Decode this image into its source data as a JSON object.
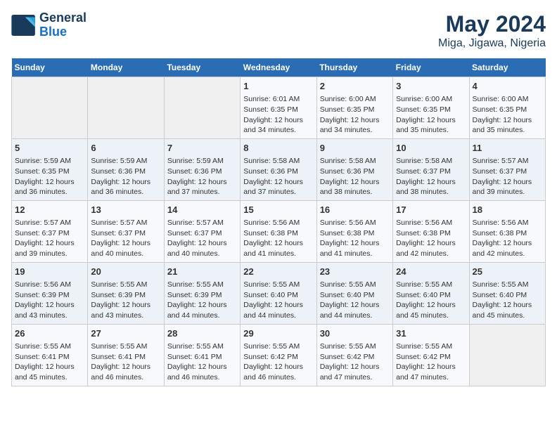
{
  "header": {
    "logo_line1": "General",
    "logo_line2": "Blue",
    "title": "May 2024",
    "subtitle": "Miga, Jigawa, Nigeria"
  },
  "weekdays": [
    "Sunday",
    "Monday",
    "Tuesday",
    "Wednesday",
    "Thursday",
    "Friday",
    "Saturday"
  ],
  "weeks": [
    [
      {
        "num": "",
        "info": ""
      },
      {
        "num": "",
        "info": ""
      },
      {
        "num": "",
        "info": ""
      },
      {
        "num": "1",
        "info": "Sunrise: 6:01 AM\nSunset: 6:35 PM\nDaylight: 12 hours\nand 34 minutes."
      },
      {
        "num": "2",
        "info": "Sunrise: 6:00 AM\nSunset: 6:35 PM\nDaylight: 12 hours\nand 34 minutes."
      },
      {
        "num": "3",
        "info": "Sunrise: 6:00 AM\nSunset: 6:35 PM\nDaylight: 12 hours\nand 35 minutes."
      },
      {
        "num": "4",
        "info": "Sunrise: 6:00 AM\nSunset: 6:35 PM\nDaylight: 12 hours\nand 35 minutes."
      }
    ],
    [
      {
        "num": "5",
        "info": "Sunrise: 5:59 AM\nSunset: 6:35 PM\nDaylight: 12 hours\nand 36 minutes."
      },
      {
        "num": "6",
        "info": "Sunrise: 5:59 AM\nSunset: 6:36 PM\nDaylight: 12 hours\nand 36 minutes."
      },
      {
        "num": "7",
        "info": "Sunrise: 5:59 AM\nSunset: 6:36 PM\nDaylight: 12 hours\nand 37 minutes."
      },
      {
        "num": "8",
        "info": "Sunrise: 5:58 AM\nSunset: 6:36 PM\nDaylight: 12 hours\nand 37 minutes."
      },
      {
        "num": "9",
        "info": "Sunrise: 5:58 AM\nSunset: 6:36 PM\nDaylight: 12 hours\nand 38 minutes."
      },
      {
        "num": "10",
        "info": "Sunrise: 5:58 AM\nSunset: 6:37 PM\nDaylight: 12 hours\nand 38 minutes."
      },
      {
        "num": "11",
        "info": "Sunrise: 5:57 AM\nSunset: 6:37 PM\nDaylight: 12 hours\nand 39 minutes."
      }
    ],
    [
      {
        "num": "12",
        "info": "Sunrise: 5:57 AM\nSunset: 6:37 PM\nDaylight: 12 hours\nand 39 minutes."
      },
      {
        "num": "13",
        "info": "Sunrise: 5:57 AM\nSunset: 6:37 PM\nDaylight: 12 hours\nand 40 minutes."
      },
      {
        "num": "14",
        "info": "Sunrise: 5:57 AM\nSunset: 6:37 PM\nDaylight: 12 hours\nand 40 minutes."
      },
      {
        "num": "15",
        "info": "Sunrise: 5:56 AM\nSunset: 6:38 PM\nDaylight: 12 hours\nand 41 minutes."
      },
      {
        "num": "16",
        "info": "Sunrise: 5:56 AM\nSunset: 6:38 PM\nDaylight: 12 hours\nand 41 minutes."
      },
      {
        "num": "17",
        "info": "Sunrise: 5:56 AM\nSunset: 6:38 PM\nDaylight: 12 hours\nand 42 minutes."
      },
      {
        "num": "18",
        "info": "Sunrise: 5:56 AM\nSunset: 6:38 PM\nDaylight: 12 hours\nand 42 minutes."
      }
    ],
    [
      {
        "num": "19",
        "info": "Sunrise: 5:56 AM\nSunset: 6:39 PM\nDaylight: 12 hours\nand 43 minutes."
      },
      {
        "num": "20",
        "info": "Sunrise: 5:55 AM\nSunset: 6:39 PM\nDaylight: 12 hours\nand 43 minutes."
      },
      {
        "num": "21",
        "info": "Sunrise: 5:55 AM\nSunset: 6:39 PM\nDaylight: 12 hours\nand 44 minutes."
      },
      {
        "num": "22",
        "info": "Sunrise: 5:55 AM\nSunset: 6:40 PM\nDaylight: 12 hours\nand 44 minutes."
      },
      {
        "num": "23",
        "info": "Sunrise: 5:55 AM\nSunset: 6:40 PM\nDaylight: 12 hours\nand 44 minutes."
      },
      {
        "num": "24",
        "info": "Sunrise: 5:55 AM\nSunset: 6:40 PM\nDaylight: 12 hours\nand 45 minutes."
      },
      {
        "num": "25",
        "info": "Sunrise: 5:55 AM\nSunset: 6:40 PM\nDaylight: 12 hours\nand 45 minutes."
      }
    ],
    [
      {
        "num": "26",
        "info": "Sunrise: 5:55 AM\nSunset: 6:41 PM\nDaylight: 12 hours\nand 45 minutes."
      },
      {
        "num": "27",
        "info": "Sunrise: 5:55 AM\nSunset: 6:41 PM\nDaylight: 12 hours\nand 46 minutes."
      },
      {
        "num": "28",
        "info": "Sunrise: 5:55 AM\nSunset: 6:41 PM\nDaylight: 12 hours\nand 46 minutes."
      },
      {
        "num": "29",
        "info": "Sunrise: 5:55 AM\nSunset: 6:42 PM\nDaylight: 12 hours\nand 46 minutes."
      },
      {
        "num": "30",
        "info": "Sunrise: 5:55 AM\nSunset: 6:42 PM\nDaylight: 12 hours\nand 47 minutes."
      },
      {
        "num": "31",
        "info": "Sunrise: 5:55 AM\nSunset: 6:42 PM\nDaylight: 12 hours\nand 47 minutes."
      },
      {
        "num": "",
        "info": ""
      }
    ]
  ]
}
